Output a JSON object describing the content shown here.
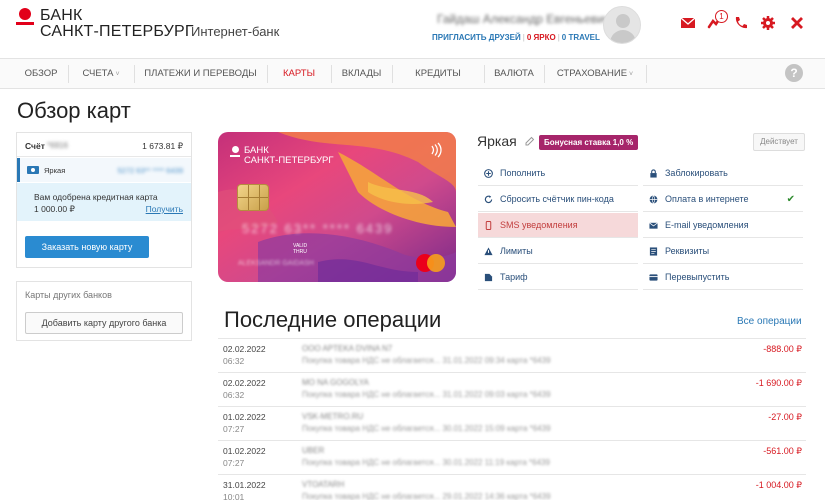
{
  "header": {
    "bank_line1": "БАНК",
    "bank_line2": "САНКТ-ПЕТЕРБУРГ",
    "product": "Интернет-банк",
    "user_name": "Гайдаш Александр Евгеньевич",
    "links": [
      "ПРИГЛАСИТЬ ДРУЗЕЙ",
      "0 ЯРКО",
      "0 TRAVEL"
    ],
    "notification_count": "1",
    "icons": [
      "mail-icon",
      "notification-icon",
      "phone-icon",
      "gear-icon",
      "close-icon"
    ]
  },
  "nav": {
    "items": [
      "ОБЗОР",
      "СЧЕТА",
      "ПЛАТЕЖИ И ПЕРЕВОДЫ",
      "КАРТЫ",
      "ВКЛАДЫ",
      "КРЕДИТЫ",
      "ВАЛЮТА",
      "СТРАХОВАНИЕ"
    ],
    "active": "КАРТЫ",
    "help": "?"
  },
  "page_title": "Обзор карт",
  "accounts": {
    "account_label": "Счёт",
    "account_number": "*6916",
    "account_amount": "1 673.81 ₽",
    "card_name": "Яркая",
    "card_number": "5272 63** **** 6439",
    "approved_text": "Вам одобрена кредитная карта",
    "approved_amount": "1 000.00 ₽",
    "approved_link": "Получить",
    "order_button": "Заказать новую карту"
  },
  "other_banks": {
    "title": "Карты других банков",
    "add_button": "Добавить карту другого банка"
  },
  "card": {
    "bank_line1": "БАНК",
    "bank_line2": "САНКТ-ПЕТЕРБУРГ",
    "number": "5272 63** **** 6439",
    "valid_line1": "VALID",
    "valid_line2": "THRU",
    "holder": "ALEKSANDR GAIDASH",
    "name": "Яркая",
    "bonus": "Бонусная ставка 1,0 %",
    "status": "Действует"
  },
  "actions_left": [
    {
      "label": "Пополнить",
      "icon": "plus-circle-icon"
    },
    {
      "label": "Сбросить счётчик пин-кода",
      "icon": "refresh-icon"
    },
    {
      "label": "SMS уведомления",
      "icon": "phone-sms-icon"
    },
    {
      "label": "Лимиты",
      "icon": "warning-icon"
    },
    {
      "label": "Тариф",
      "icon": "tariff-icon"
    }
  ],
  "actions_right": [
    {
      "label": "Заблокировать",
      "icon": "lock-icon"
    },
    {
      "label": "Оплата в интернете",
      "icon": "globe-icon",
      "check": "✔"
    },
    {
      "label": "E-mail уведомления",
      "icon": "envelope-icon"
    },
    {
      "label": "Реквизиты",
      "icon": "list-icon"
    },
    {
      "label": "Перевыпустить",
      "icon": "card-reissue-icon"
    }
  ],
  "operations": {
    "title": "Последние операции",
    "all_link": "Все операции",
    "rows": [
      {
        "date": "02.02.2022",
        "time": "06:32",
        "merchant": "OOO APTEKA DVINA N7",
        "desc": "Покупка товара НДС не облагается... 31.01.2022 09:34 карта *6439",
        "amount": "-888.00 ₽"
      },
      {
        "date": "02.02.2022",
        "time": "06:32",
        "merchant": "MO NA GOGOLYA",
        "desc": "Покупка товара НДС не облагается... 31.01.2022 09:03 карта *6439",
        "amount": "-1 690.00 ₽"
      },
      {
        "date": "01.02.2022",
        "time": "07:27",
        "merchant": "VSK-METRO.RU",
        "desc": "Покупка товара НДС не облагается... 30.01.2022 15:09 карта *6439",
        "amount": "-27.00 ₽"
      },
      {
        "date": "01.02.2022",
        "time": "07:27",
        "merchant": "UBER",
        "desc": "Покупка товара НДС не облагается... 30.01.2022 11:19 карта *6439",
        "amount": "-561.00 ₽"
      },
      {
        "date": "31.01.2022",
        "time": "10:01",
        "merchant": "VTOATARH",
        "desc": "Покупка товара НДС не облагается... 29.01.2022 14:36 карта *6439",
        "amount": "-1 004.00 ₽"
      }
    ]
  },
  "colors": {
    "brand_red": "#d71921",
    "link_blue": "#2a78b5",
    "bonus_purple": "#a6256a",
    "button_blue": "#2a8bd1"
  }
}
